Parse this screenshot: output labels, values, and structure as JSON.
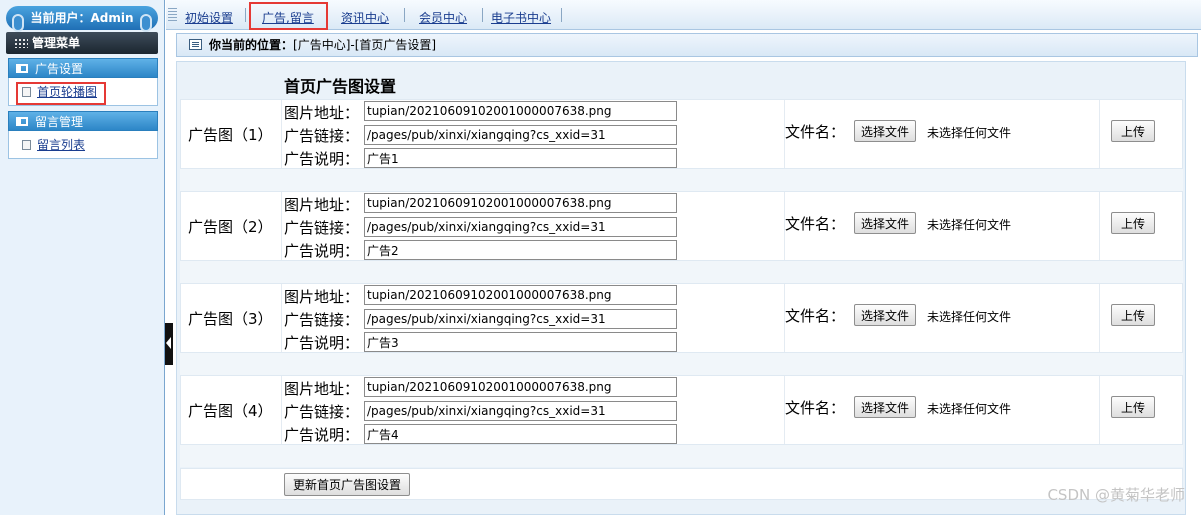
{
  "sidebar": {
    "user_label": "当前用户：Admin",
    "menu_title": "管理菜单",
    "sections": [
      {
        "title": "广告设置",
        "items": [
          {
            "label": "首页轮播图"
          }
        ]
      },
      {
        "title": "留言管理",
        "items": [
          {
            "label": "留言列表"
          }
        ]
      }
    ]
  },
  "nav": {
    "tabs": [
      {
        "label": "初始设置"
      },
      {
        "label": "广告,留言"
      },
      {
        "label": "资讯中心"
      },
      {
        "label": "会员中心"
      },
      {
        "label": "电子书中心"
      }
    ]
  },
  "breadcrumb": {
    "label": "你当前的位置：",
    "path": "[广告中心]-[首页广告设置]"
  },
  "form": {
    "title": "首页广告图设置",
    "image_label": "图片地址：",
    "link_label": "广告链接：",
    "desc_label": "广告说明：",
    "file_label": "文件名：",
    "choose_file_label": "选择文件",
    "no_file_text": "未选择任何文件",
    "upload_label": "上传",
    "submit_label": "更新首页广告图设置",
    "ads": [
      {
        "label": "广告图（1）",
        "image": "tupian/20210609102001000007638.png",
        "link": "/pages/pub/xinxi/xiangqing?cs_xxid=31",
        "desc": "广告1"
      },
      {
        "label": "广告图（2）",
        "image": "tupian/20210609102001000007638.png",
        "link": "/pages/pub/xinxi/xiangqing?cs_xxid=31",
        "desc": "广告2"
      },
      {
        "label": "广告图（3）",
        "image": "tupian/20210609102001000007638.png",
        "link": "/pages/pub/xinxi/xiangqing?cs_xxid=31",
        "desc": "广告3"
      },
      {
        "label": "广告图（4）",
        "image": "tupian/20210609102001000007638.png",
        "link": "/pages/pub/xinxi/xiangqing?cs_xxid=31",
        "desc": "广告4"
      }
    ]
  },
  "watermark": "CSDN @黄菊华老师"
}
